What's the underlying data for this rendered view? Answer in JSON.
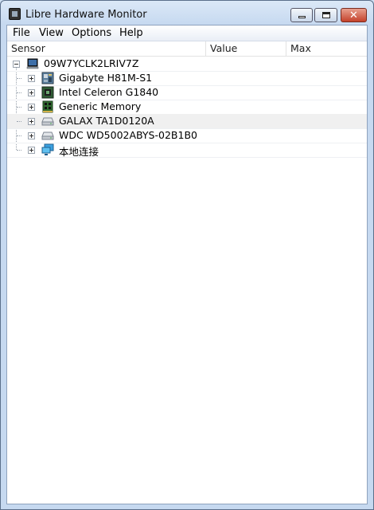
{
  "window": {
    "title": "Libre Hardware Monitor"
  },
  "menu": {
    "file": "File",
    "view": "View",
    "options": "Options",
    "help": "Help"
  },
  "columns": {
    "sensor": "Sensor",
    "value": "Value",
    "max": "Max"
  },
  "tree": {
    "root": {
      "label": "09W7YCLK2LRIV7Z",
      "icon": "computer-icon"
    },
    "children": [
      {
        "label": "Gigabyte H81M-S1",
        "icon": "motherboard-icon"
      },
      {
        "label": "Intel Celeron G1840",
        "icon": "cpu-icon"
      },
      {
        "label": "Generic Memory",
        "icon": "memory-icon"
      },
      {
        "label": "GALAX TA1D0120A",
        "icon": "drive-icon"
      },
      {
        "label": "WDC WD5002ABYS-02B1B0",
        "icon": "drive-icon"
      },
      {
        "label": "本地连接",
        "icon": "network-icon"
      }
    ]
  }
}
